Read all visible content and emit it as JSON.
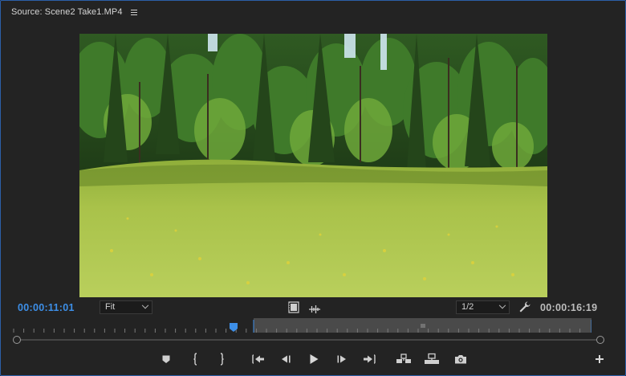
{
  "panel": {
    "title": "Source: Scene2 Take1.MP4",
    "accent_color": "#2b5fa8"
  },
  "timecode": {
    "current": "00:00:11:01",
    "current_color": "#3d8fe8",
    "duration": "00:00:16:19"
  },
  "zoom": {
    "selected": "Fit"
  },
  "resolution": {
    "selected": "1/2"
  },
  "icons": {
    "panel_menu": "hamburger-icon",
    "drag_video": "film-strip-icon",
    "drag_audio": "waveform-icon",
    "settings": "wrench-icon"
  },
  "transport": [
    {
      "name": "add-marker-button",
      "icon": "marker-icon"
    },
    {
      "name": "mark-in-button",
      "icon": "mark-in-icon"
    },
    {
      "name": "mark-out-button",
      "icon": "mark-out-icon"
    },
    {
      "name": "go-to-in-button",
      "icon": "go-to-in-icon"
    },
    {
      "name": "step-back-button",
      "icon": "step-back-icon"
    },
    {
      "name": "play-button",
      "icon": "play-icon"
    },
    {
      "name": "step-forward-button",
      "icon": "step-forward-icon"
    },
    {
      "name": "go-to-out-button",
      "icon": "go-to-out-icon"
    },
    {
      "name": "insert-button",
      "icon": "insert-icon"
    },
    {
      "name": "overwrite-button",
      "icon": "overwrite-icon"
    },
    {
      "name": "export-frame-button",
      "icon": "camera-icon"
    },
    {
      "name": "button-editor-button",
      "icon": "plus-icon"
    }
  ]
}
